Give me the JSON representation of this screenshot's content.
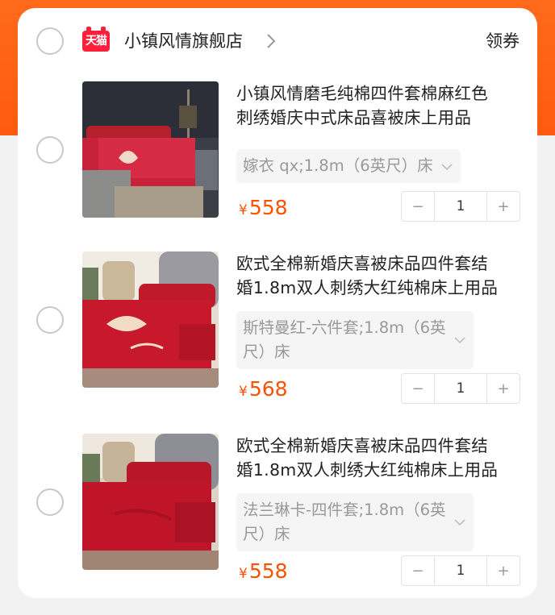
{
  "shop": {
    "badge": "天猫",
    "name": "小镇风情旗舰店",
    "coupon_label": "领券"
  },
  "items": [
    {
      "title_line1": "小镇风情磨毛纯棉四件套棉麻红色",
      "title_line2": "刺绣婚庆中式床品喜被床上用品",
      "sku_line1": "嫁衣 qx;1.8m（6英尺）床",
      "sku_line2": "",
      "price_symbol": "¥",
      "price": "558",
      "quantity": "1"
    },
    {
      "title_line1": "欧式全棉新婚庆喜被床品四件套结",
      "title_line2": "婚1.8m双人刺绣大红纯棉床上用品",
      "sku_line1": "斯特曼红-六件套;1.8m（6英",
      "sku_line2": "尺）床",
      "price_symbol": "¥",
      "price": "568",
      "quantity": "1"
    },
    {
      "title_line1": "欧式全棉新婚庆喜被床品四件套结",
      "title_line2": "婚1.8m双人刺绣大红纯棉床上用品",
      "sku_line1": "法兰琳卡-四件套;1.8m（6英",
      "sku_line2": "尺）床",
      "price_symbol": "¥",
      "price": "558",
      "quantity": "1"
    }
  ],
  "stepper": {
    "minus": "−",
    "plus": "+"
  },
  "colors": {
    "header_orange": "#ff6a1a",
    "price": "#ff5000",
    "tmall_red": "#ff1f3a"
  }
}
